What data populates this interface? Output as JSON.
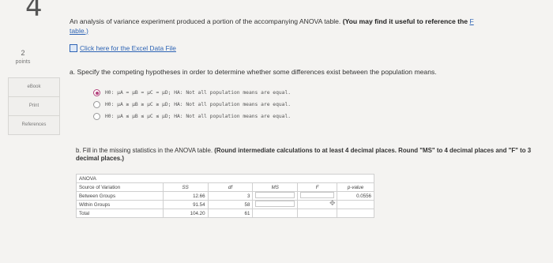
{
  "question_number": "4",
  "points": {
    "value": "2",
    "label": "points"
  },
  "sidebar": [
    "eBook",
    "Print",
    "References"
  ],
  "intro": {
    "text": "An analysis of variance experiment produced a portion of the accompanying ANOVA table.",
    "bold": "(You may find it useful to reference the ",
    "link": "table.)",
    "link_prefix": "F"
  },
  "excel_link": "Click here for the Excel Data File",
  "part_a": "a. Specify the competing hypotheses in order to determine whether some differences exist between the population means.",
  "options": [
    {
      "text": "H0: μA = μB = μC = μD; HA: Not all population means are equal.",
      "selected": true
    },
    {
      "text": "H0: μA ≥ μB ≥ μC ≥ μD; HA: Not all population means are equal.",
      "selected": false
    },
    {
      "text": "H0: μA ≤ μB ≤ μC ≤ μD; HA: Not all population means are equal.",
      "selected": false
    }
  ],
  "part_b": {
    "text": "b. Fill in the missing statistics in the ANOVA table.",
    "bold": "(Round intermediate calculations to at least 4 decimal places. Round \"MS\" to 4 decimal places and \"F\" to 3 decimal places.)"
  },
  "anova": {
    "title": "ANOVA",
    "headers": [
      "Source of Variation",
      "SS",
      "df",
      "MS",
      "F",
      "p-value"
    ],
    "rows": [
      {
        "source": "Between Groups",
        "ss": "12.66",
        "df": "3",
        "p": "0.0556"
      },
      {
        "source": "Within Groups",
        "ss": "91.54",
        "df": "58"
      },
      {
        "source": "Total",
        "ss": "104.20",
        "df": "61"
      }
    ]
  }
}
